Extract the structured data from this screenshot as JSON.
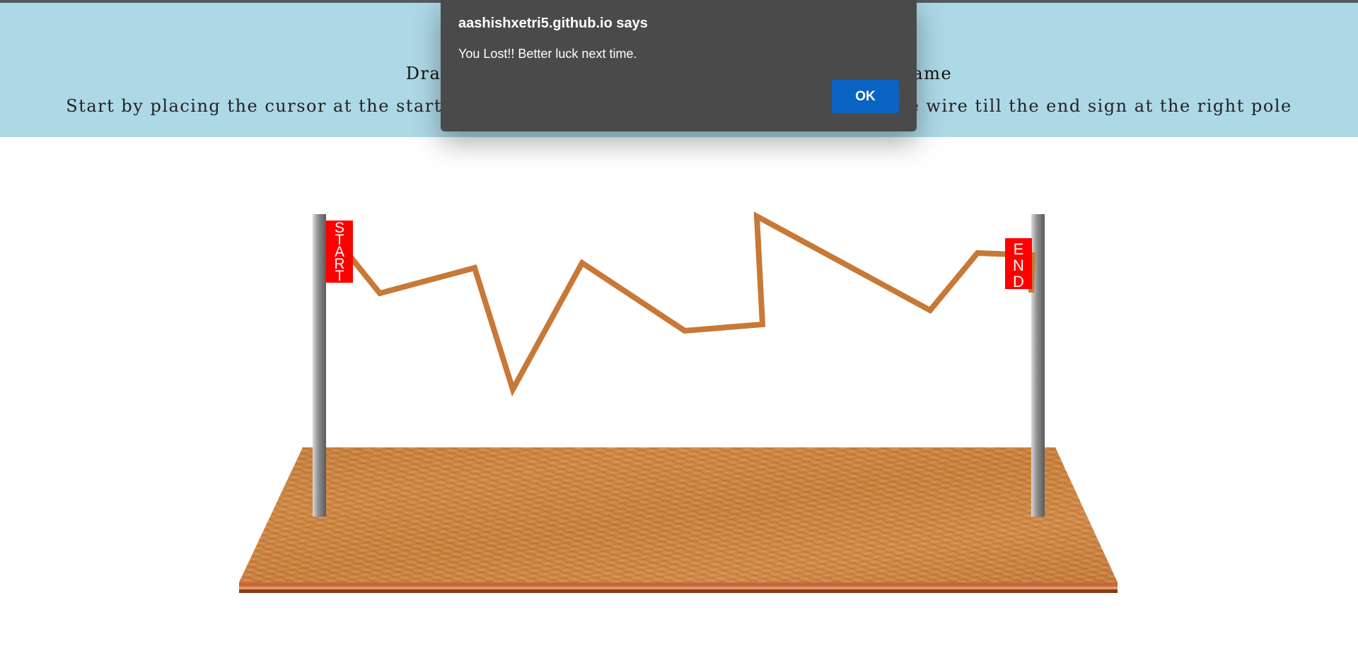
{
  "banner": {
    "title_left": "Drag m",
    "title_right": "game",
    "subtitle_left": "Start by placing the cursor at the start-",
    "subtitle_right": "e wire till the end sign at the right pole",
    "background_color": "#add8e6"
  },
  "game": {
    "start_sign": "START",
    "end_sign": "END",
    "wire_color": "#c87837",
    "sign_color": "#ff0000",
    "board": "wooden base"
  },
  "dialog": {
    "origin": "aashishxetri5.github.io says",
    "message": "You Lost!! Better luck next time.",
    "ok_label": "OK",
    "background_color": "#4a4a4a",
    "button_color": "#0b63c3"
  }
}
